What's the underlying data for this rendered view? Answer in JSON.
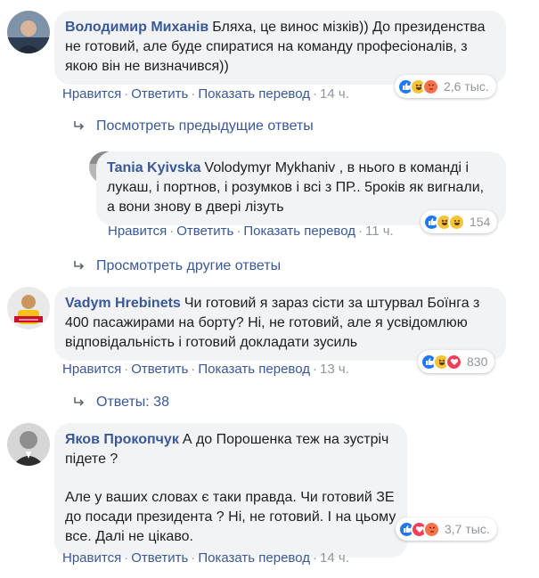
{
  "labels": {
    "like": "Нравится",
    "reply": "Ответить",
    "translate": "Показать перевод"
  },
  "colors": {
    "link": "#385898",
    "bubble": "#f2f3f5",
    "meta": "#90949c"
  },
  "comments": [
    {
      "author": "Володимир Миханів",
      "text": "Бляха, це винос мізків)) До президенства не готовий, але буде спиратися на команду професіоналів, з якою він не визначився))",
      "time": "14 ч.",
      "reaction_icons": [
        "like-icon",
        "haha-icon",
        "angry-icon"
      ],
      "reaction_count": "2,6 тыс."
    },
    {
      "author": "Tania Kyivska",
      "text": "Volodymyr Mykhaniv , в нього в команді і лукаш, і портнов, і розумков і всі з ПР.. 5років як вигнали, а вони знову в двері лізуть",
      "time": "11 ч.",
      "reaction_icons": [
        "like-icon",
        "haha-icon",
        "haha-icon"
      ],
      "reaction_count": "154"
    },
    {
      "author": "Vadym Hrebinets",
      "text": "Чи готовий я зараз сісти за штурвал Боїнга з 400 пасажирами на борту? Ні, не готовий, але я усвідомлюю відповідальність і готовий докладати зусиль",
      "time": "13 ч.",
      "reaction_icons": [
        "like-icon",
        "haha-icon",
        "love-icon"
      ],
      "reaction_count": "830"
    },
    {
      "author": "Яков Прокопчук",
      "text": "А до Порошенка теж на зустріч підете ?",
      "text2": "Але у ваших словах є таки правда. Чи готовий ЗЕ до посади президента ? Ні, не готовий. І на цьому все. Далі не цікаво.",
      "time": "14 ч.",
      "reaction_icons": [
        "like-icon",
        "love-icon",
        "angry-icon"
      ],
      "reaction_count": "3,7 тыс."
    }
  ],
  "links": {
    "previous_replies": "Посмотреть предыдущие ответы",
    "other_replies": "Просмотреть другие ответы",
    "replies_count": "Ответы: 38"
  }
}
